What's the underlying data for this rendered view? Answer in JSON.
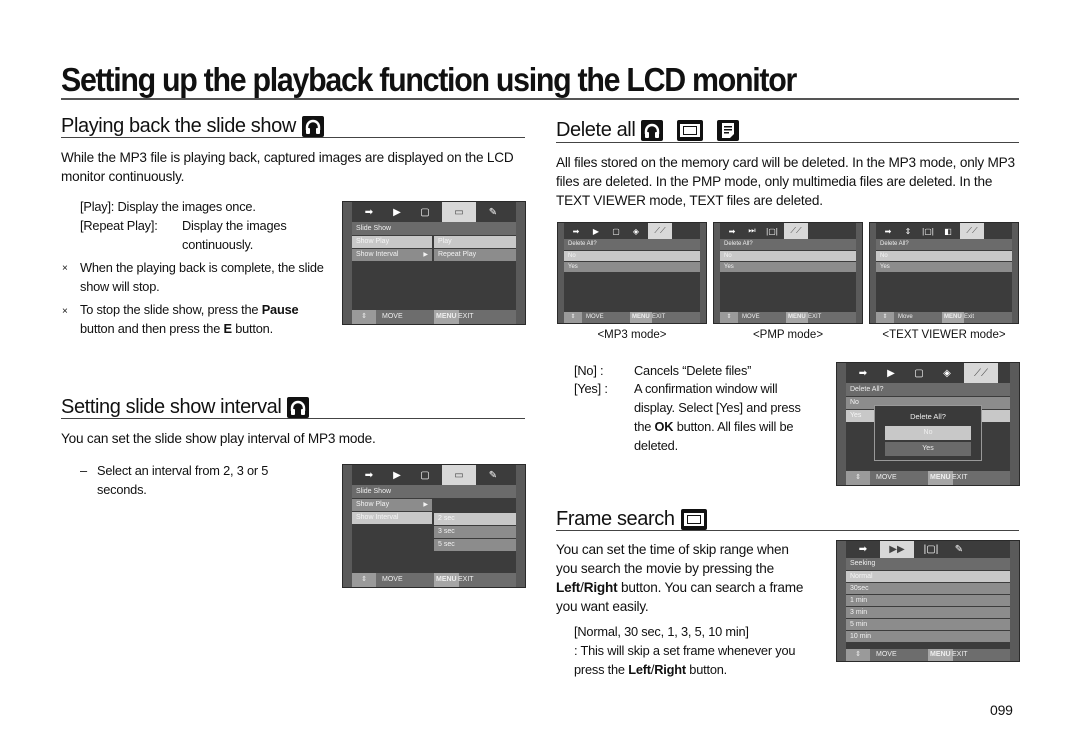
{
  "page": {
    "title": "Setting up the playback function using the LCD monitor",
    "page_number": "099"
  },
  "slideshow": {
    "heading": "Playing back the slide show",
    "heading_icon": "headphones-icon",
    "intro": "While the MP3 file is playing back, captured images are displayed on the LCD monitor continuously.",
    "play_label": "[Play]: Display the images once.",
    "repeat_label": "[Repeat Play]:",
    "repeat_desc_1": "Display the images",
    "repeat_desc_2": "continuously.",
    "note1_mark": "×",
    "note1": "When the playing back is complete, the slide show will stop.",
    "note2_mark": "×",
    "note2_pre": "To stop the slide show, press the ",
    "note2_bold1": "Pause",
    "note2_mid": " button and then press the ",
    "note2_bold2": "E",
    "note2_post": " button.",
    "lcd": {
      "header": "Slide Show",
      "rows": [
        "Show Play",
        "Show Interval"
      ],
      "arrow": "▶",
      "sub_rows": [
        "Play",
        "Repeat Play"
      ],
      "move": "MOVE",
      "menu": "MENU",
      "exit": "EXIT"
    }
  },
  "interval": {
    "heading": "Setting slide show interval",
    "heading_icon": "headphones-icon",
    "intro": "You can set the slide show play interval of MP3 mode.",
    "dash": "–",
    "bullet": "Select an interval from 2, 3 or 5 seconds.",
    "lcd": {
      "header": "Slide Show",
      "rows": [
        "Show Play",
        "Show Interval"
      ],
      "arrow": "▶",
      "sub_rows": [
        "2 sec",
        "3 sec",
        "5 sec"
      ],
      "move": "MOVE",
      "menu": "MENU",
      "exit": "EXIT"
    }
  },
  "delete_all": {
    "heading": "Delete all",
    "heading_icons": [
      "headphones-icon",
      "film-icon",
      "document-icon"
    ],
    "intro": "All files stored on the memory card will be deleted. In the MP3 mode, only MP3 files are deleted. In the PMP mode, only multimedia files are deleted. In the TEXT VIEWER mode, TEXT files are deleted.",
    "screens": [
      {
        "caption": "<MP3 mode>",
        "header": "Delete All?",
        "rows": [
          "No",
          "Yes"
        ],
        "move": "MOVE",
        "menu": "MENU",
        "exit": "EXIT"
      },
      {
        "caption": "<PMP mode>",
        "header": "Delete All?",
        "rows": [
          "No",
          "Yes"
        ],
        "move": "MOVE",
        "menu": "MENU",
        "exit": "EXIT"
      },
      {
        "caption": "<TEXT VIEWER mode>",
        "header": "Delete All?",
        "rows": [
          "No",
          "Yes"
        ],
        "move": "Move",
        "menu": "MENU",
        "exit": "Exit"
      }
    ],
    "no_label": "[No] :",
    "no_desc": "Cancels “Delete files”",
    "yes_label": "[Yes] :",
    "yes_desc_1": "A confirmation window will",
    "yes_desc_2": "display. Select [Yes] and press",
    "yes_desc_3_pre": "the ",
    "yes_desc_3_bold": "OK",
    "yes_desc_3_post": " button. All files will be",
    "yes_desc_4": "deleted.",
    "confirm_lcd": {
      "header": "Delete All?",
      "rows": [
        "No",
        "Yes"
      ],
      "popup_title": "Delete All?",
      "popup_buttons": [
        "No",
        "Yes"
      ],
      "move": "MOVE",
      "menu": "MENU",
      "exit": "EXIT"
    }
  },
  "frame_search": {
    "heading": "Frame search",
    "heading_icon": "film-icon",
    "intro_1": "You can set the time of skip range when",
    "intro_2": "you search the movie by pressing the",
    "intro_3_b1": "Left",
    "intro_3_sep": "/",
    "intro_3_b2": "Right",
    "intro_3_post": " button. You can search a frame",
    "intro_4": "you want easily.",
    "options_line": "[Normal, 30 sec, 1, 3, 5, 10 min]",
    "desc_1": ": This will skip a set frame whenever you",
    "desc_2_pre": "press the ",
    "desc_2_b1": "Left",
    "desc_2_sep": "/",
    "desc_2_b2": "Right",
    "desc_2_post": " button.",
    "lcd": {
      "header": "Seeking",
      "rows": [
        "Normal",
        "30sec",
        "1  min",
        "3  min",
        "5  min",
        "10 min"
      ],
      "move": "MOVE",
      "menu": "MENU",
      "exit": "EXIT"
    }
  }
}
